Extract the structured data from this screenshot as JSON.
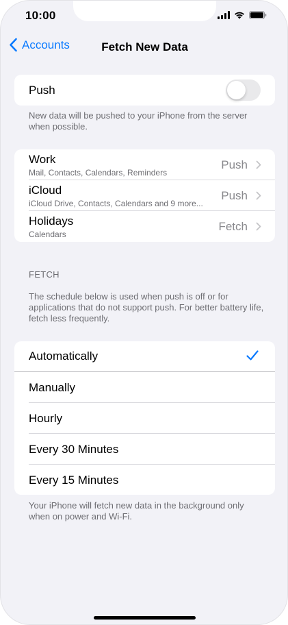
{
  "status_bar": {
    "time": "10:00"
  },
  "nav": {
    "back_label": "Accounts",
    "title": "Fetch New Data"
  },
  "push": {
    "label": "Push",
    "enabled": false,
    "footnote": "New data will be pushed to your iPhone from the server when possible."
  },
  "accounts": [
    {
      "name": "Work",
      "detail": "Mail, Contacts, Calendars, Reminders",
      "value": "Push"
    },
    {
      "name": "iCloud",
      "detail": "iCloud Drive, Contacts, Calendars and 9 more...",
      "value": "Push"
    },
    {
      "name": "Holidays",
      "detail": "Calendars",
      "value": "Fetch"
    }
  ],
  "fetch": {
    "header": "FETCH",
    "description": "The schedule below is used when push is off or for applications that do not support push. For better battery life, fetch less frequently.",
    "options": [
      {
        "label": "Automatically",
        "selected": true
      },
      {
        "label": "Manually",
        "selected": false
      },
      {
        "label": "Hourly",
        "selected": false
      },
      {
        "label": "Every 30 Minutes",
        "selected": false
      },
      {
        "label": "Every 15 Minutes",
        "selected": false
      }
    ],
    "footnote": "Your iPhone will fetch new data in the background only when on power and Wi-Fi."
  },
  "colors": {
    "accent": "#0a7aff",
    "background": "#f2f2f7",
    "secondary_text": "#6d6d72"
  }
}
